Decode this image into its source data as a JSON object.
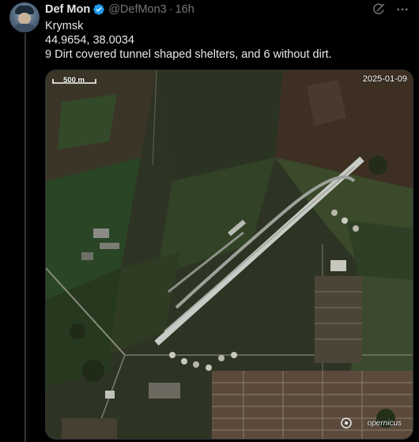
{
  "tweet": {
    "author_name": "Def Mon",
    "handle": "@DefMon3",
    "separator": "·",
    "time": "16h",
    "lines": [
      "Krymsk",
      "44.9654, 38.0034",
      "9 Dirt covered tunnel shaped shelters, and 6 without dirt."
    ]
  },
  "image": {
    "scale_label": "500 m",
    "date": "2025-01-09",
    "watermark": "opernicus"
  },
  "icons": {
    "verified": "verified-badge-icon",
    "grok": "grok-icon",
    "more": "more-icon"
  },
  "colors": {
    "background": "#000000",
    "text": "#e7e9ea",
    "secondary": "#71767b",
    "verified": "#1d9bf0"
  }
}
